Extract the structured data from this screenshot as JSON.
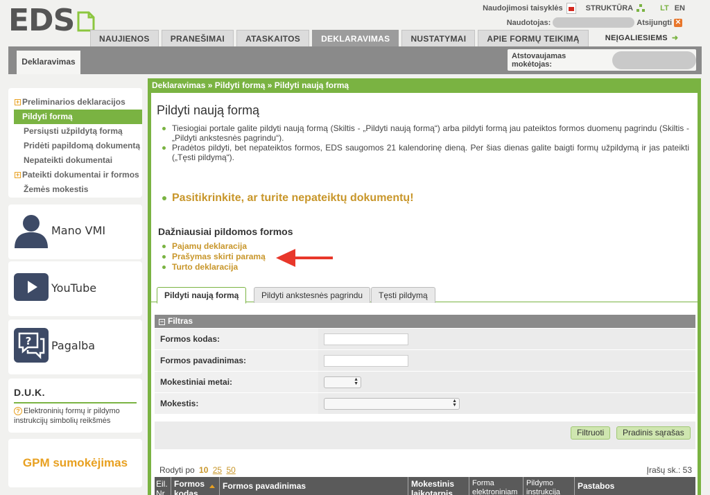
{
  "header": {
    "logo_text": "EDS",
    "rules_link": "Naudojimosi taisyklės",
    "structure_link": "STRUKTŪRA",
    "lang_lt": "LT",
    "lang_en": "EN",
    "user_label": "Naudotojas:",
    "logout_label": "Atsijungti"
  },
  "nav": {
    "tabs": [
      "NAUJIENOS",
      "PRANEŠIMAI",
      "ATASKAITOS",
      "DEKLARAVIMAS",
      "NUSTATYMAI",
      "APIE FORMŲ TEIKIMĄ"
    ],
    "active_index": 3,
    "accessibility": "NEĮGALIESIEMS"
  },
  "subbar": {
    "section_tab": "Deklaravimas",
    "payer_label": "Atstovaujamas mokėtojas:"
  },
  "sidebar": {
    "items": [
      {
        "label": "Preliminarios deklaracijos",
        "expandable": true
      },
      {
        "label": "Pildyti formą",
        "active": true
      },
      {
        "label": "Persiųsti užpildytą formą"
      },
      {
        "label": "Pridėti papildomą dokumentą"
      },
      {
        "label": "Nepateikti dokumentai"
      },
      {
        "label": "Pateikti dokumentai ir formos",
        "expandable": true
      },
      {
        "label": "Žemės mokestis"
      }
    ],
    "cards": {
      "vmi": "Mano VMI",
      "youtube": "YouTube",
      "help": "Pagalba"
    },
    "duk": {
      "title": "D.U.K.",
      "text": "Elektroninių formų ir pildymo instrukcijų simbolių reikšmės"
    },
    "gpm": "GPM sumokėjimas"
  },
  "main": {
    "breadcrumb": "Deklaravimas » Pildyti formą » Pildyti naują formą",
    "title": "Pildyti naują formą",
    "intro": [
      "Tiesiogiai portale galite pildyti naują formą (Skiltis - „Pildyti naują formą“) arba pildyti formą jau pateiktos formos duomenų pagrindu (Skiltis - „Pildyti ankstesnės pagrindu“).",
      "Pradėtos pildyti, bet nepateiktos formos, EDS saugomos 21 kalendorinę dieną. Per šias dienas galite baigti formų užpildymą ir jas pateikti („Tęsti pildymą“)."
    ],
    "warning": "Pasitikrinkite, ar turite nepateiktų dokumentų!",
    "freq_title": "Dažniausiai pildomos formos",
    "freq_forms": [
      "Pajamų deklaracija",
      "Prašymas skirti paramą",
      "Turto deklaracija"
    ],
    "tabs": [
      "Pildyti naują formą",
      "Pildyti ankstesnės pagrindu",
      "Tęsti pildymą"
    ],
    "filter": {
      "title": "Filtras",
      "form_code_label": "Formos kodas:",
      "form_code_value": "",
      "form_name_label": "Formos pavadinimas:",
      "form_name_value": "",
      "tax_year_label": "Mokestiniai metai:",
      "tax_year_value": "",
      "tax_label": "Mokestis:",
      "tax_value": "",
      "filter_button": "Filtruoti",
      "reset_button": "Pradinis sąrašas"
    },
    "paging": {
      "show_label": "Rodyti po",
      "sizes": [
        "10",
        "25",
        "50"
      ],
      "current": "10",
      "records_label": "Įrašų sk.: 53"
    },
    "table_headers": [
      "Eil. Nr.",
      "Formos kodas",
      "Formos pavadinimas",
      "Mokestinis laikotarpis",
      "Forma elektroniniam pildymui",
      "Pildymo instrukcija",
      "Pastabos"
    ]
  },
  "colors": {
    "brand_green": "#7ab342",
    "link_gold": "#c8962a",
    "accent_orange": "#e8a020",
    "arrow_red": "#e8372a"
  }
}
